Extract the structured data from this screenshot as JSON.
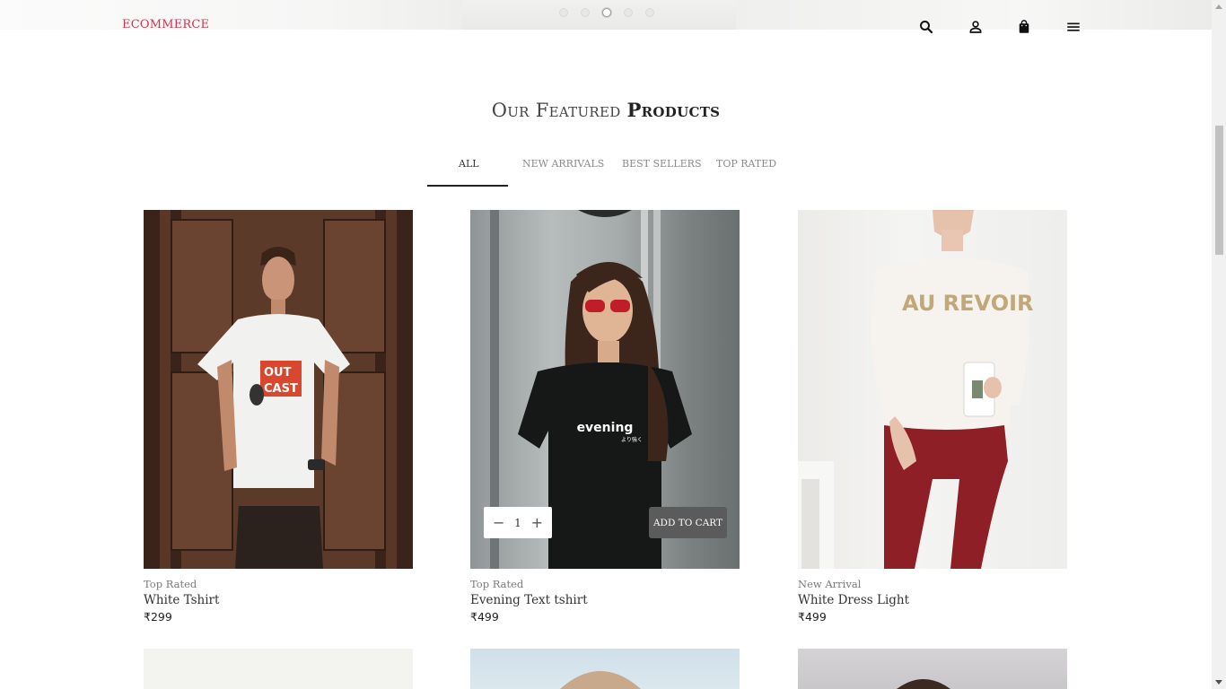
{
  "header": {
    "logo": "ECOMMERCE",
    "icons": [
      "search-icon",
      "user-icon",
      "bag-icon",
      "menu-icon"
    ]
  },
  "slider": {
    "dots": 5,
    "active_dot": 3
  },
  "section": {
    "title_light": "Our Featured",
    "title_bold": "Products"
  },
  "tabs": [
    {
      "label": "ALL",
      "active": true
    },
    {
      "label": "NEW ARRIVALS",
      "active": false
    },
    {
      "label": "BEST SELLERS",
      "active": false
    },
    {
      "label": "TOP RATED",
      "active": false
    }
  ],
  "products": [
    {
      "category": "Top Rated",
      "name": "White Tshirt",
      "price": "₹299",
      "print_text_1": "OUT",
      "print_text_2": "CAST"
    },
    {
      "category": "Top Rated",
      "name": "Evening Text tshirt",
      "price": "₹499",
      "print_text": "evening",
      "print_subtext": "より強く"
    },
    {
      "category": "New Arrival",
      "name": "White Dress Light",
      "price": "₹499",
      "print_text": "AU REVOIR"
    }
  ],
  "card_actions": {
    "quantity": "1",
    "minus": "−",
    "plus": "+",
    "add_to_cart": "ADD TO CART"
  },
  "colors": {
    "logo": "#d0344a",
    "button": "#5b5b5b",
    "pants": "#8e1f26"
  }
}
